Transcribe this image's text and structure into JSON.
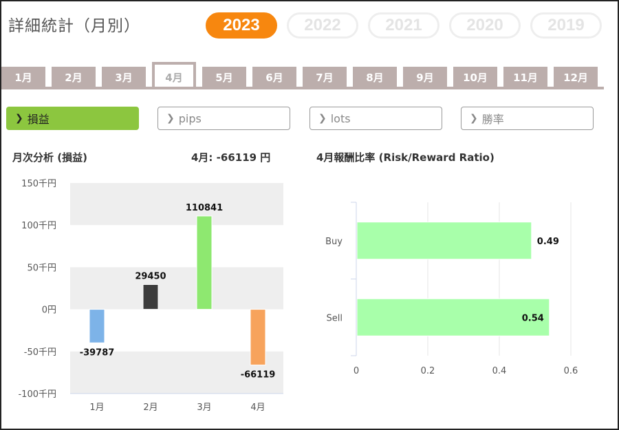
{
  "page_title": "詳細統計（月別）",
  "years": [
    "2023",
    "2022",
    "2021",
    "2020",
    "2019"
  ],
  "active_year": "2023",
  "months": [
    "1月",
    "2月",
    "3月",
    "4月",
    "5月",
    "6月",
    "7月",
    "8月",
    "9月",
    "10月",
    "11月",
    "12月"
  ],
  "active_month_index": 3,
  "metrics": {
    "chevron": "chevron-right-icon",
    "items": [
      "損益",
      "pips",
      "lots",
      "勝率"
    ],
    "active_index": 0
  },
  "left_panel": {
    "title": "月次分析 (損益)",
    "summary": "4月:  -66119 円"
  },
  "right_panel": {
    "title": "4月報酬比率 (Risk/Reward Ratio)"
  },
  "colors": {
    "accent": "#f7870f",
    "tab": "#bcaeac",
    "metric_active": "#8cc63f",
    "bar_jan": "#7db3e8",
    "bar_feb": "#3c3c3c",
    "bar_mar": "#8ee870",
    "bar_apr": "#f7a35c",
    "rr_bar": "#a8ffaa"
  },
  "chart_data": [
    {
      "type": "bar",
      "categories": [
        "1月",
        "2月",
        "3月",
        "4月"
      ],
      "values": [
        -39787,
        29450,
        110841,
        -66119
      ],
      "data_labels": [
        "-39787",
        "29450",
        "110841",
        "-66119"
      ],
      "yticks": [
        "150千円",
        "100千円",
        "50千円",
        "0円",
        "-50千円",
        "-100千円"
      ],
      "ytick_values": [
        150000,
        100000,
        50000,
        0,
        -50000,
        -100000
      ],
      "ylim": [
        -100000,
        150000
      ],
      "grid": "alternating-bands"
    },
    {
      "type": "bar",
      "orientation": "horizontal",
      "categories": [
        "Buy",
        "Sell"
      ],
      "values": [
        0.49,
        0.54
      ],
      "data_labels": [
        "0.49",
        "0.54"
      ],
      "xticks": [
        "0",
        "0.2",
        "0.4",
        "0.6"
      ],
      "xtick_values": [
        0,
        0.2,
        0.4,
        0.6
      ],
      "xlim": [
        0,
        0.6
      ],
      "grid": "vertical-lines"
    }
  ]
}
